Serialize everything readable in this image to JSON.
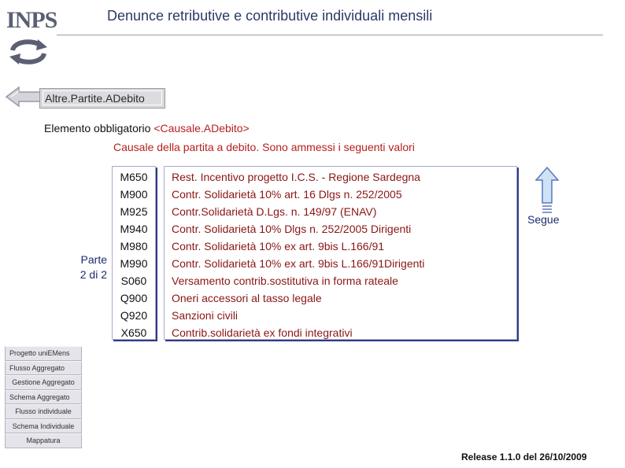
{
  "header": {
    "logo_text": "INPS",
    "title": "Denunce retributive e contributive individuali mensili"
  },
  "breadcrumb": {
    "label": "Altre.Partite.ADebito"
  },
  "element": {
    "prefix": "Elemento obbligatorio ",
    "tag": "<Causale.ADebito>",
    "description": "Causale della partita a debito. Sono ammessi i seguenti valori"
  },
  "page_indicator": {
    "line1": "Parte",
    "line2": "2 di 2"
  },
  "codes_table": {
    "rows": [
      {
        "code": "M650",
        "description": "Rest. Incentivo progetto I.C.S. - Regione Sardegna"
      },
      {
        "code": "M900",
        "description": "Contr. Solidarietà 10% art. 16 Dlgs n. 252/2005"
      },
      {
        "code": "M925",
        "description": "Contr.Solidarietà D.Lgs. n. 149/97 (ENAV)"
      },
      {
        "code": "M940",
        "description": "Contr. Solidarietà 10%  Dlgs n. 252/2005 Dirigenti"
      },
      {
        "code": "M980",
        "description": "Contr. Solidarietà 10% ex art. 9bis L.166/91"
      },
      {
        "code": "M990",
        "description": "Contr. Solidarietà 10% ex art. 9bis L.166/91Dirigenti"
      },
      {
        "code": "S060",
        "description": "Versamento contrib.sostitutiva in forma rateale"
      },
      {
        "code": "Q900",
        "description": "Oneri accessori al tasso legale"
      },
      {
        "code": "Q920",
        "description": "Sanzioni civili"
      },
      {
        "code": "X650",
        "description": "Contrib.solidarietà ex fondi integrativi"
      }
    ]
  },
  "next": {
    "label": "Segue",
    "icon": "up-arrow-icon"
  },
  "side_menu": {
    "items": [
      "Progetto uniEMens",
      "Flusso Aggregato",
      "Gestione Aggregato",
      "Schema Aggregato",
      "Flusso individuale",
      "Schema Individuale",
      "Mappatura"
    ]
  },
  "footer": {
    "release": "Release 1.1.0 del 26/10/2009"
  },
  "colors": {
    "title": "#2a3a66",
    "accent_red": "#b71e1e",
    "navy": "#1a2c6e",
    "box_shadow": "#2e3a88"
  }
}
